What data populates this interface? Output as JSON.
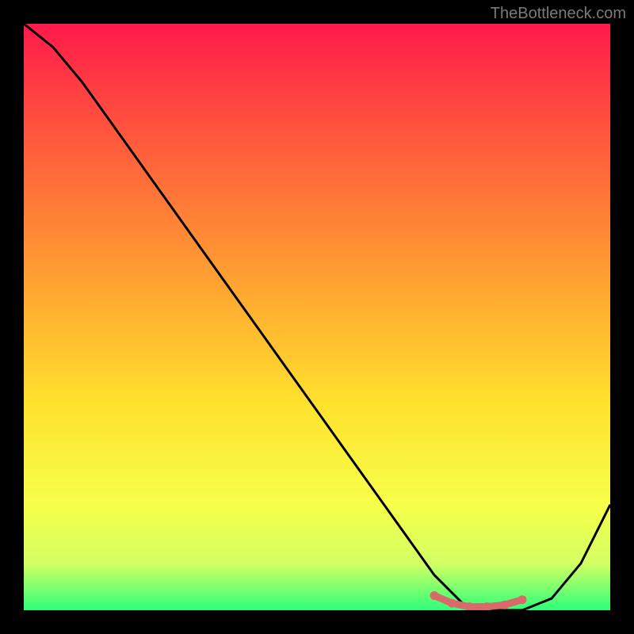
{
  "watermark": "TheBottleneck.com",
  "chart_data": {
    "type": "line",
    "title": "",
    "xlabel": "",
    "ylabel": "",
    "xlim": [
      0,
      100
    ],
    "ylim": [
      0,
      100
    ],
    "x": [
      0,
      5,
      10,
      15,
      20,
      25,
      30,
      35,
      40,
      45,
      50,
      55,
      60,
      65,
      70,
      75,
      80,
      85,
      90,
      95,
      100
    ],
    "values": [
      100,
      96,
      90,
      83,
      76,
      69,
      62,
      55,
      48,
      41,
      34,
      27,
      20,
      13,
      6,
      1,
      0,
      0,
      2,
      8,
      18
    ],
    "gradient_stops": [
      {
        "pos": 0.0,
        "color": "#ff1a4b"
      },
      {
        "pos": 0.2,
        "color": "#ff5a3c"
      },
      {
        "pos": 0.45,
        "color": "#ffa531"
      },
      {
        "pos": 0.65,
        "color": "#ffe22e"
      },
      {
        "pos": 0.82,
        "color": "#f7ff4a"
      },
      {
        "pos": 0.92,
        "color": "#d4ff63"
      },
      {
        "pos": 1.0,
        "color": "#2eff7a"
      }
    ],
    "highlight_segment": {
      "color": "#d96a6a",
      "x": [
        70,
        73,
        76,
        79,
        82,
        85
      ],
      "values": [
        2.5,
        1.2,
        0.6,
        0.6,
        0.9,
        1.8
      ]
    }
  }
}
